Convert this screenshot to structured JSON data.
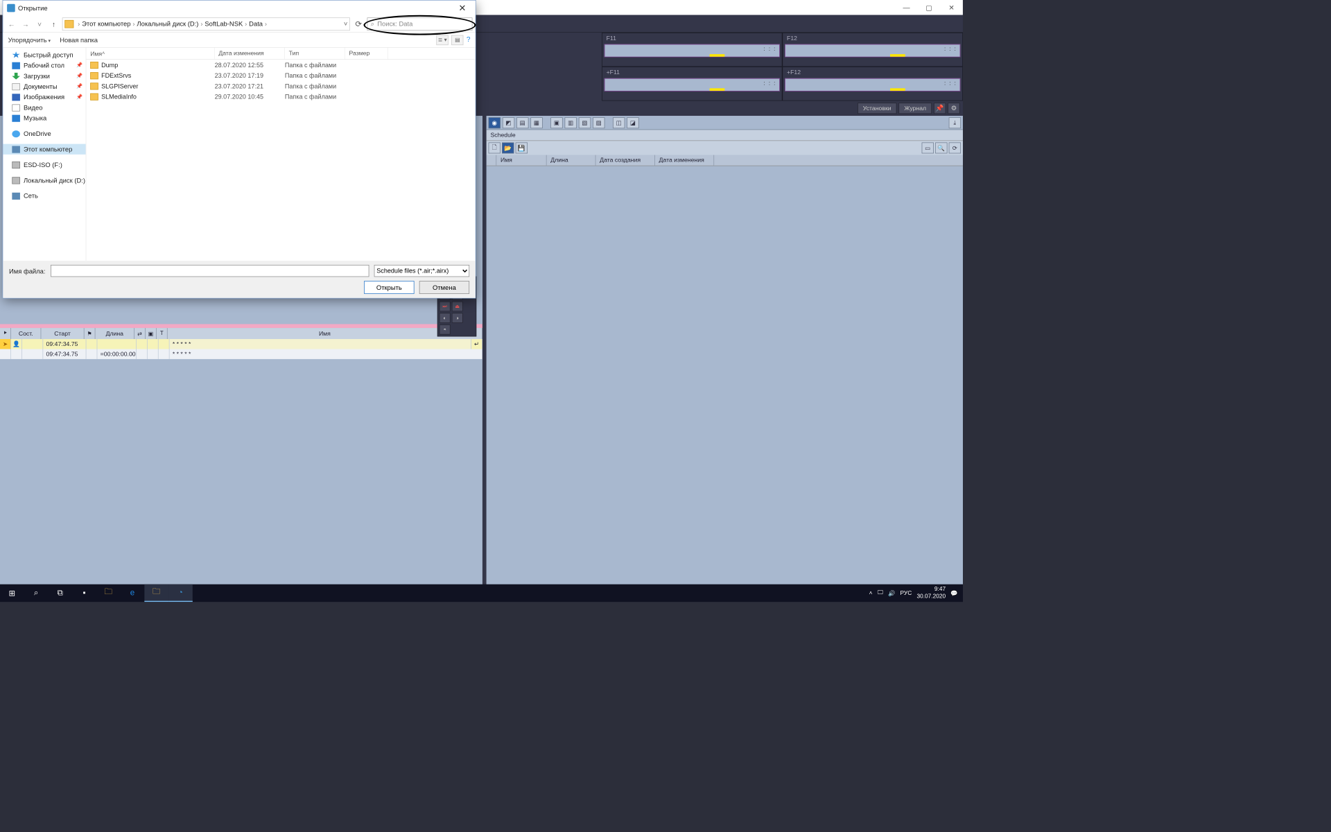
{
  "app": {
    "titlebar": {
      "min": "—",
      "max": "▢",
      "close": "✕"
    },
    "f_panels": [
      [
        "F11",
        "F12"
      ],
      [
        "+F11",
        "+F12"
      ]
    ],
    "mid_toolbar": {
      "settings": "Установки",
      "journal": "Журнал"
    },
    "schedule": {
      "tab": "Schedule",
      "headers": {
        "name": "Имя",
        "length": "Длина",
        "created": "Дата создания",
        "modified": "Дата изменения"
      }
    },
    "timeline": {
      "headers": {
        "status": "Сост.",
        "start": "Старт",
        "length": "Длина",
        "name": "Имя"
      },
      "rows": [
        {
          "start": "09:47:34.75",
          "length": "",
          "name": "* * * * *"
        },
        {
          "start": "09:47:34.75",
          "length": "=00:00:00.00",
          "name": "* * * * *"
        }
      ]
    }
  },
  "dialog": {
    "title": "Открытие",
    "breadcrumbs": [
      "Этот компьютер",
      "Локальный диск (D:)",
      "SoftLab-NSK",
      "Data"
    ],
    "search_placeholder": "Поиск: Data",
    "toolbar": {
      "organize": "Упорядочить",
      "newfolder": "Новая папка"
    },
    "tree": [
      {
        "label": "Быстрый доступ",
        "icon": "ti-star"
      },
      {
        "label": "Рабочий стол",
        "icon": "ti-desk",
        "pin": true
      },
      {
        "label": "Загрузки",
        "icon": "ti-down",
        "pin": true
      },
      {
        "label": "Документы",
        "icon": "ti-doc",
        "pin": true
      },
      {
        "label": "Изображения",
        "icon": "ti-img",
        "pin": true
      },
      {
        "label": "Видео",
        "icon": "ti-vid"
      },
      {
        "label": "Музыка",
        "icon": "ti-mus"
      },
      {
        "spacer": true
      },
      {
        "label": "OneDrive",
        "icon": "ti-cloud"
      },
      {
        "spacer": true
      },
      {
        "label": "Этот компьютер",
        "icon": "ti-pc",
        "selected": true
      },
      {
        "spacer": true
      },
      {
        "label": "ESD-ISO (F:)",
        "icon": "ti-drv"
      },
      {
        "spacer": true
      },
      {
        "label": "Локальный диск (D:)",
        "icon": "ti-drv"
      },
      {
        "spacer": true
      },
      {
        "label": "Сеть",
        "icon": "ti-net"
      }
    ],
    "list_headers": {
      "name": "Имя",
      "date": "Дата изменения",
      "type": "Тип",
      "size": "Размер"
    },
    "list": [
      {
        "name": "Dump",
        "date": "28.07.2020 12:55",
        "type": "Папка с файлами"
      },
      {
        "name": "FDExtSrvs",
        "date": "23.07.2020 17:19",
        "type": "Папка с файлами"
      },
      {
        "name": "SLGPIServer",
        "date": "23.07.2020 17:21",
        "type": "Папка с файлами"
      },
      {
        "name": "SLMediaInfo",
        "date": "29.07.2020 10:45",
        "type": "Папка с файлами"
      }
    ],
    "filename_label": "Имя файла:",
    "filetype": "Schedule files (*.air;*.airx)",
    "open": "Открыть",
    "cancel": "Отмена"
  },
  "taskbar": {
    "lang": "РУС",
    "time": "9:47",
    "date": "30.07.2020"
  }
}
